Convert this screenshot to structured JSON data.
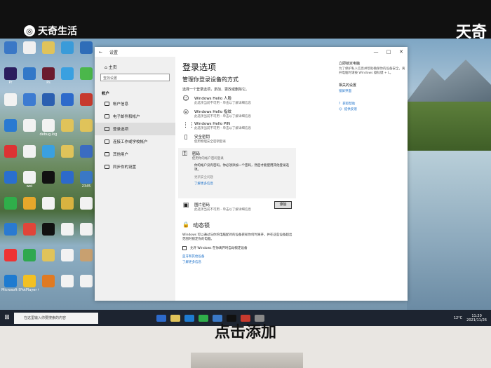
{
  "brand": {
    "name": "天奇生活",
    "corner": "天奇"
  },
  "desktop_icons": [
    {
      "label": "",
      "color": "#3a78c6"
    },
    {
      "label": "",
      "color": "#f0f0f0"
    },
    {
      "label": "",
      "color": "#e0c35a"
    },
    {
      "label": "",
      "color": "#3a9bd9"
    },
    {
      "label": "",
      "color": "#2f6db8"
    },
    {
      "label": "Pr",
      "color": "#2b1d5e"
    },
    {
      "label": "",
      "color": "#3278c8"
    },
    {
      "label": "Ps",
      "color": "#6b1b2e"
    },
    {
      "label": "",
      "color": "#3aa0e0"
    },
    {
      "label": "",
      "color": "#4bb74b"
    },
    {
      "label": "",
      "color": "#f2f2f2"
    },
    {
      "label": "",
      "color": "#3d7bd1"
    },
    {
      "label": "",
      "color": "#2b5fb0"
    },
    {
      "label": "",
      "color": "#2d6acb"
    },
    {
      "label": "",
      "color": "#c73a2e"
    },
    {
      "label": "",
      "color": "#2a7ad1"
    },
    {
      "label": "",
      "color": "#f2f2f2"
    },
    {
      "label": "debug.log",
      "color": "#f2f2f2"
    },
    {
      "label": "",
      "color": "#e0c35a"
    },
    {
      "label": "",
      "color": "#e0c35a"
    },
    {
      "label": "",
      "color": "#d33"
    },
    {
      "label": "",
      "color": "#f2f2f2"
    },
    {
      "label": "",
      "color": "#3aa0e0"
    },
    {
      "label": "",
      "color": "#e0c35a"
    },
    {
      "label": "",
      "color": "#3b6cc1"
    },
    {
      "label": "",
      "color": "#2a6fcf"
    },
    {
      "label": "wei",
      "color": "#f2f2f2"
    },
    {
      "label": "",
      "color": "#111"
    },
    {
      "label": "",
      "color": "#2d6acb"
    },
    {
      "label": "2345",
      "color": "#3a78c6"
    },
    {
      "label": "",
      "color": "#2fae4a"
    },
    {
      "label": "",
      "color": "#e6a72b"
    },
    {
      "label": "",
      "color": "#f2f2f2"
    },
    {
      "label": "",
      "color": "#d8b340"
    },
    {
      "label": "",
      "color": "#f2f2f2"
    },
    {
      "label": "",
      "color": "#2a7ad1"
    },
    {
      "label": "",
      "color": "#e0453a"
    },
    {
      "label": "",
      "color": "#111"
    },
    {
      "label": "",
      "color": "#f2f2f2"
    },
    {
      "label": "",
      "color": "#f2f2f2"
    },
    {
      "label": "",
      "color": "#e33"
    },
    {
      "label": "",
      "color": "#2fa84f"
    },
    {
      "label": "",
      "color": "#e0c35a"
    },
    {
      "label": "",
      "color": "#f2f2f2"
    },
    {
      "label": "",
      "color": "#c8a070"
    },
    {
      "label": "Microsoft Edge",
      "color": "#1e7bd0"
    },
    {
      "label": "PotPlayer 64 bit",
      "color": "#f2c022"
    },
    {
      "label": "",
      "color": "#e07a22"
    },
    {
      "label": "",
      "color": "#f2f2f2"
    },
    {
      "label": "",
      "color": "#f2f2f2"
    }
  ],
  "window": {
    "app_title": "设置",
    "side": {
      "home": "主页",
      "search_placeholder": "查找设置",
      "category": "帐户",
      "items": [
        "帐户信息",
        "电子邮件和帐户",
        "登录选项",
        "连接工作或学校帐户",
        "其他用户",
        "同步你的设置"
      ]
    },
    "main": {
      "title": "登录选项",
      "subtitle": "管理你登录设备的方式",
      "desc": "选择一个登录选项，添加、更改或删除它。",
      "options": [
        {
          "icon": "face-icon",
          "glyph": "☺",
          "name": "Windows Hello 人脸",
          "sub": "此选项当前不可用 - 单击以了解详细信息"
        },
        {
          "icon": "fingerprint-icon",
          "glyph": "◎",
          "name": "Windows Hello 指纹",
          "sub": "此选项当前不可用 - 单击以了解详细信息"
        },
        {
          "icon": "pin-icon",
          "glyph": "⋮⋮",
          "name": "Windows Hello PIN",
          "sub": "此选项当前不可用 - 单击以了解详细信息"
        },
        {
          "icon": "security-key-icon",
          "glyph": "▯",
          "name": "安全密钥",
          "sub": "使用物理安全密钥登录"
        }
      ],
      "password": {
        "name": "密码",
        "sub": "使用你的帐户密码登录",
        "body": "你的帐户没有密码。你必须添加一个密码，然后才能使用其他登录选项。",
        "muted": "更新安全问题",
        "link": "了解更多信息",
        "add_label": "添加"
      },
      "picture_password": {
        "name": "图片密码",
        "sub": "此选项当前不可用 - 单击以了解详细信息"
      },
      "dynamic_lock": {
        "title": "动态锁",
        "desc": "Windows 可以通过与你的电脑配对的设备获知你何时离开，并在这些设备超出范围时锁定你的电脑。",
        "checkbox": "允许 Windows 在你离开时自动锁定设备",
        "link1": "蓝牙和其他设备",
        "link2": "了解更多信息"
      }
    },
    "right": {
      "h1": "立即锁定电脑",
      "p1": "为了保护私人信息并帮助确保你的设备安全，离开电脑时请按 Windows 徽标键 + L。",
      "h2": "相关的设置",
      "l1": "锁屏界面",
      "l2": "获取帮助",
      "l3": "提供反馈"
    }
  },
  "taskbar": {
    "search_placeholder": "在这里输入你要搜索的内容",
    "temp": "12°C",
    "time": "11:20",
    "date": "2021/11/26"
  },
  "caption": "点击添加"
}
